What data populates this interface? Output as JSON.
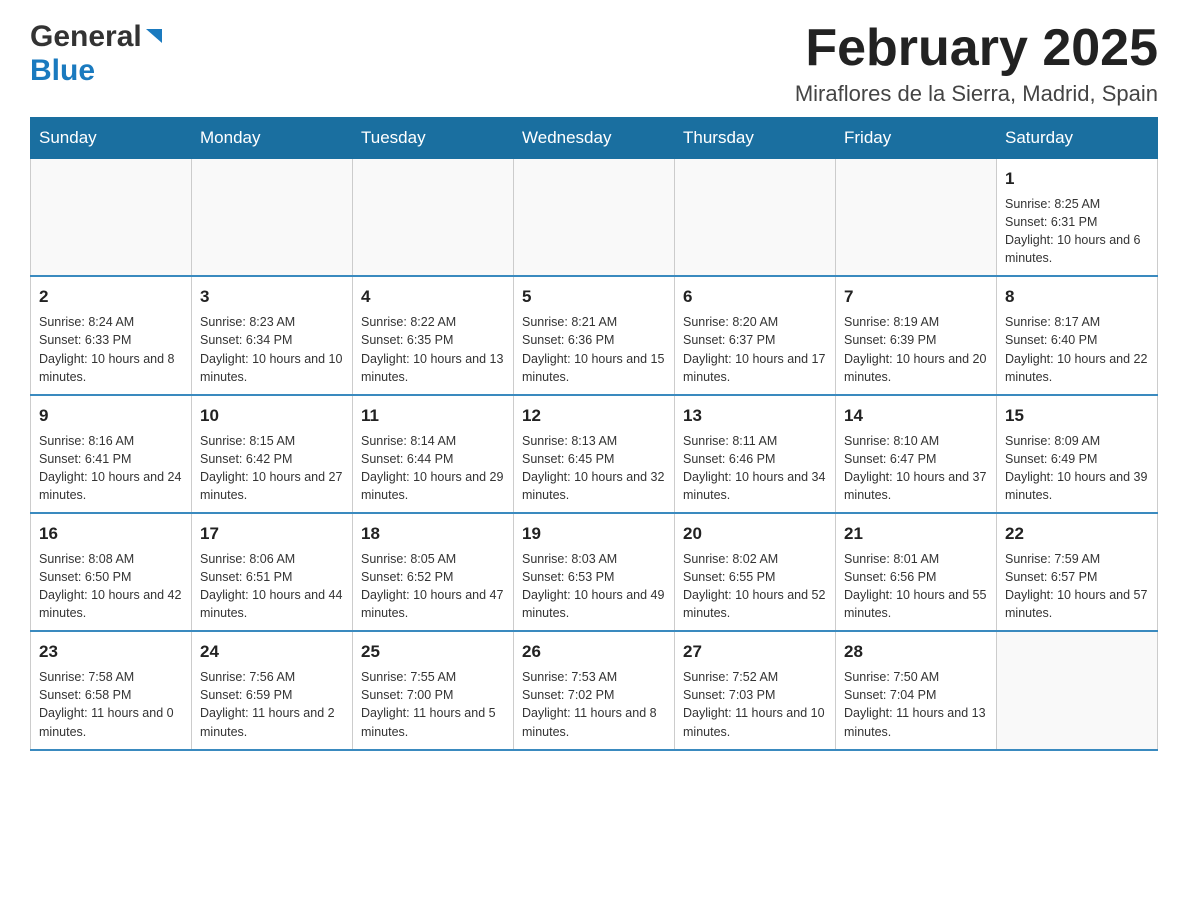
{
  "header": {
    "logo": {
      "general": "General",
      "blue": "Blue"
    },
    "title": "February 2025",
    "location": "Miraflores de la Sierra, Madrid, Spain"
  },
  "days_of_week": [
    "Sunday",
    "Monday",
    "Tuesday",
    "Wednesday",
    "Thursday",
    "Friday",
    "Saturday"
  ],
  "weeks": [
    [
      {
        "day": "",
        "info": ""
      },
      {
        "day": "",
        "info": ""
      },
      {
        "day": "",
        "info": ""
      },
      {
        "day": "",
        "info": ""
      },
      {
        "day": "",
        "info": ""
      },
      {
        "day": "",
        "info": ""
      },
      {
        "day": "1",
        "info": "Sunrise: 8:25 AM\nSunset: 6:31 PM\nDaylight: 10 hours and 6 minutes."
      }
    ],
    [
      {
        "day": "2",
        "info": "Sunrise: 8:24 AM\nSunset: 6:33 PM\nDaylight: 10 hours and 8 minutes."
      },
      {
        "day": "3",
        "info": "Sunrise: 8:23 AM\nSunset: 6:34 PM\nDaylight: 10 hours and 10 minutes."
      },
      {
        "day": "4",
        "info": "Sunrise: 8:22 AM\nSunset: 6:35 PM\nDaylight: 10 hours and 13 minutes."
      },
      {
        "day": "5",
        "info": "Sunrise: 8:21 AM\nSunset: 6:36 PM\nDaylight: 10 hours and 15 minutes."
      },
      {
        "day": "6",
        "info": "Sunrise: 8:20 AM\nSunset: 6:37 PM\nDaylight: 10 hours and 17 minutes."
      },
      {
        "day": "7",
        "info": "Sunrise: 8:19 AM\nSunset: 6:39 PM\nDaylight: 10 hours and 20 minutes."
      },
      {
        "day": "8",
        "info": "Sunrise: 8:17 AM\nSunset: 6:40 PM\nDaylight: 10 hours and 22 minutes."
      }
    ],
    [
      {
        "day": "9",
        "info": "Sunrise: 8:16 AM\nSunset: 6:41 PM\nDaylight: 10 hours and 24 minutes."
      },
      {
        "day": "10",
        "info": "Sunrise: 8:15 AM\nSunset: 6:42 PM\nDaylight: 10 hours and 27 minutes."
      },
      {
        "day": "11",
        "info": "Sunrise: 8:14 AM\nSunset: 6:44 PM\nDaylight: 10 hours and 29 minutes."
      },
      {
        "day": "12",
        "info": "Sunrise: 8:13 AM\nSunset: 6:45 PM\nDaylight: 10 hours and 32 minutes."
      },
      {
        "day": "13",
        "info": "Sunrise: 8:11 AM\nSunset: 6:46 PM\nDaylight: 10 hours and 34 minutes."
      },
      {
        "day": "14",
        "info": "Sunrise: 8:10 AM\nSunset: 6:47 PM\nDaylight: 10 hours and 37 minutes."
      },
      {
        "day": "15",
        "info": "Sunrise: 8:09 AM\nSunset: 6:49 PM\nDaylight: 10 hours and 39 minutes."
      }
    ],
    [
      {
        "day": "16",
        "info": "Sunrise: 8:08 AM\nSunset: 6:50 PM\nDaylight: 10 hours and 42 minutes."
      },
      {
        "day": "17",
        "info": "Sunrise: 8:06 AM\nSunset: 6:51 PM\nDaylight: 10 hours and 44 minutes."
      },
      {
        "day": "18",
        "info": "Sunrise: 8:05 AM\nSunset: 6:52 PM\nDaylight: 10 hours and 47 minutes."
      },
      {
        "day": "19",
        "info": "Sunrise: 8:03 AM\nSunset: 6:53 PM\nDaylight: 10 hours and 49 minutes."
      },
      {
        "day": "20",
        "info": "Sunrise: 8:02 AM\nSunset: 6:55 PM\nDaylight: 10 hours and 52 minutes."
      },
      {
        "day": "21",
        "info": "Sunrise: 8:01 AM\nSunset: 6:56 PM\nDaylight: 10 hours and 55 minutes."
      },
      {
        "day": "22",
        "info": "Sunrise: 7:59 AM\nSunset: 6:57 PM\nDaylight: 10 hours and 57 minutes."
      }
    ],
    [
      {
        "day": "23",
        "info": "Sunrise: 7:58 AM\nSunset: 6:58 PM\nDaylight: 11 hours and 0 minutes."
      },
      {
        "day": "24",
        "info": "Sunrise: 7:56 AM\nSunset: 6:59 PM\nDaylight: 11 hours and 2 minutes."
      },
      {
        "day": "25",
        "info": "Sunrise: 7:55 AM\nSunset: 7:00 PM\nDaylight: 11 hours and 5 minutes."
      },
      {
        "day": "26",
        "info": "Sunrise: 7:53 AM\nSunset: 7:02 PM\nDaylight: 11 hours and 8 minutes."
      },
      {
        "day": "27",
        "info": "Sunrise: 7:52 AM\nSunset: 7:03 PM\nDaylight: 11 hours and 10 minutes."
      },
      {
        "day": "28",
        "info": "Sunrise: 7:50 AM\nSunset: 7:04 PM\nDaylight: 11 hours and 13 minutes."
      },
      {
        "day": "",
        "info": ""
      }
    ]
  ]
}
